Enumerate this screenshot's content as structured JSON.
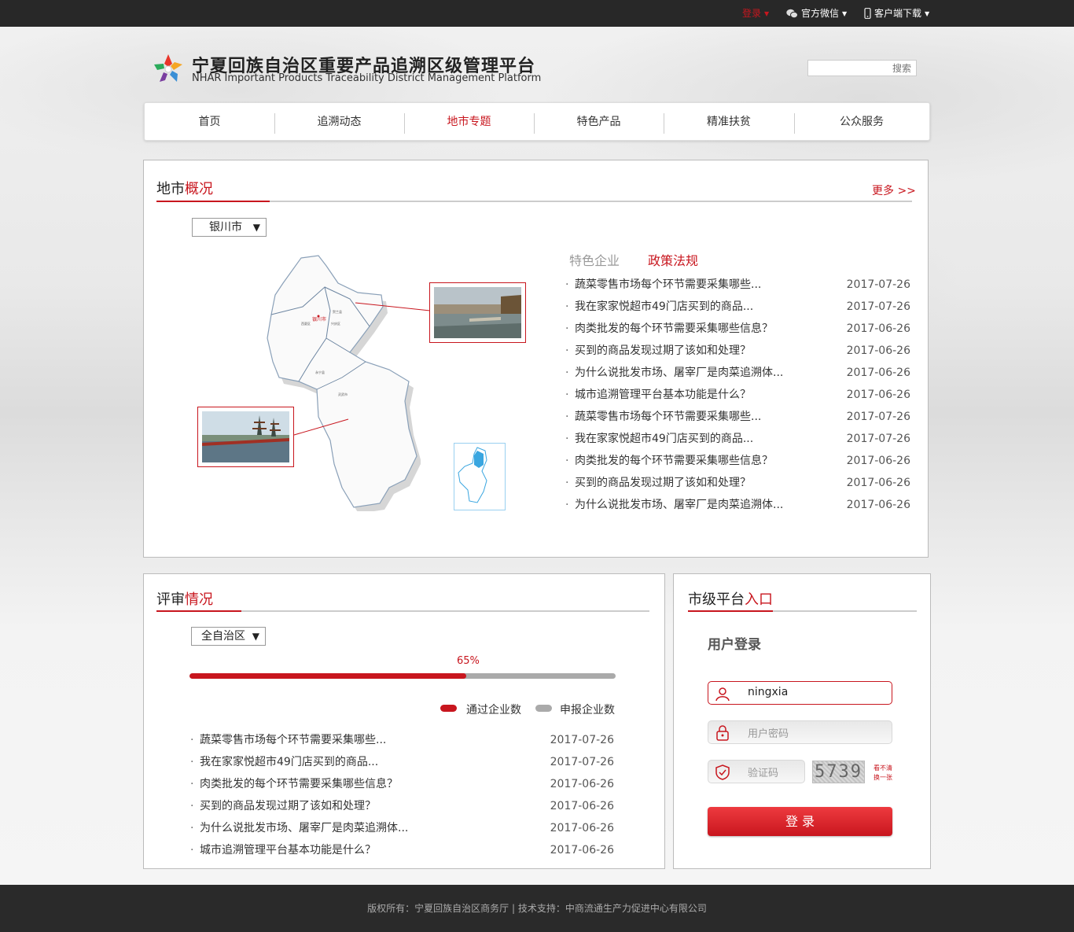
{
  "topbar": {
    "login": "登录",
    "wechat": "官方微信",
    "client": "客户端下载"
  },
  "header": {
    "title": "宁夏回族自治区重要产品追溯区级管理平台",
    "subtitle": "NHAR Important Products Traceability District Management Platform",
    "search_placeholder": "搜索"
  },
  "nav": {
    "items": [
      "首页",
      "追溯动态",
      "地市专题",
      "特色产品",
      "精准扶贫",
      "公众服务"
    ],
    "active_index": 2
  },
  "overview": {
    "title_a": "地市",
    "title_b": "概况",
    "more": "更多 >>",
    "city_select": "银川市",
    "tabs": [
      "特色企业",
      "政策法规"
    ],
    "active_tab": 1,
    "news": [
      {
        "title": "蔬菜零售市场每个环节需要采集哪些...",
        "date": "2017-07-26"
      },
      {
        "title": "我在家家悦超市49门店买到的商品...",
        "date": "2017-07-26"
      },
      {
        "title": "肉类批发的每个环节需要采集哪些信息？",
        "date": "2017-06-26"
      },
      {
        "title": "买到的商品发现过期了该如和处理？",
        "date": "2017-06-26"
      },
      {
        "title": "为什么说批发市场、屠宰厂是肉菜追溯体...",
        "date": "2017-06-26"
      },
      {
        "title": "城市追溯管理平台基本功能是什么？",
        "date": "2017-06-26"
      },
      {
        "title": "蔬菜零售市场每个环节需要采集哪些...",
        "date": "2017-07-26"
      },
      {
        "title": "我在家家悦超市49门店买到的商品...",
        "date": "2017-07-26"
      },
      {
        "title": "肉类批发的每个环节需要采集哪些信息？",
        "date": "2017-06-26"
      },
      {
        "title": "买到的商品发现过期了该如和处理？",
        "date": "2017-06-26"
      },
      {
        "title": "为什么说批发市场、屠宰厂是肉菜追溯体...",
        "date": "2017-06-26"
      }
    ]
  },
  "review": {
    "title_a": "评审",
    "title_b": "情况",
    "region_select": "全自治区",
    "progress": 0.65,
    "progress_label": "65%",
    "legend_pass": "通过企业数",
    "legend_apply": "申报企业数",
    "colors": {
      "pass": "#c8161e",
      "apply": "#aaaaaa"
    },
    "news": [
      {
        "title": "蔬菜零售市场每个环节需要采集哪些...",
        "date": "2017-07-26"
      },
      {
        "title": "我在家家悦超市49门店买到的商品...",
        "date": "2017-07-26"
      },
      {
        "title": "肉类批发的每个环节需要采集哪些信息？",
        "date": "2017-06-26"
      },
      {
        "title": "买到的商品发现过期了该如和处理？",
        "date": "2017-06-26"
      },
      {
        "title": "为什么说批发市场、屠宰厂是肉菜追溯体...",
        "date": "2017-06-26"
      },
      {
        "title": "城市追溯管理平台基本功能是什么？",
        "date": "2017-06-26"
      }
    ]
  },
  "entry": {
    "title_a": "市级平台",
    "title_b": "入口",
    "login_heading": "用户登录",
    "username": "ningxia",
    "password_placeholder": "用户密码",
    "captcha_placeholder": "验证码",
    "captcha_code": "5739",
    "captcha_refresh_1": "看不清",
    "captcha_refresh_2": "换一张",
    "login_button": "登 录"
  },
  "footer": {
    "text": "版权所有：宁夏回族自治区商务厅 | 技术支持：中商流通生产力促进中心有限公司"
  },
  "colors": {
    "accent": "#c8161e",
    "topbar": "#282828",
    "footer": "#2a2a2a"
  }
}
